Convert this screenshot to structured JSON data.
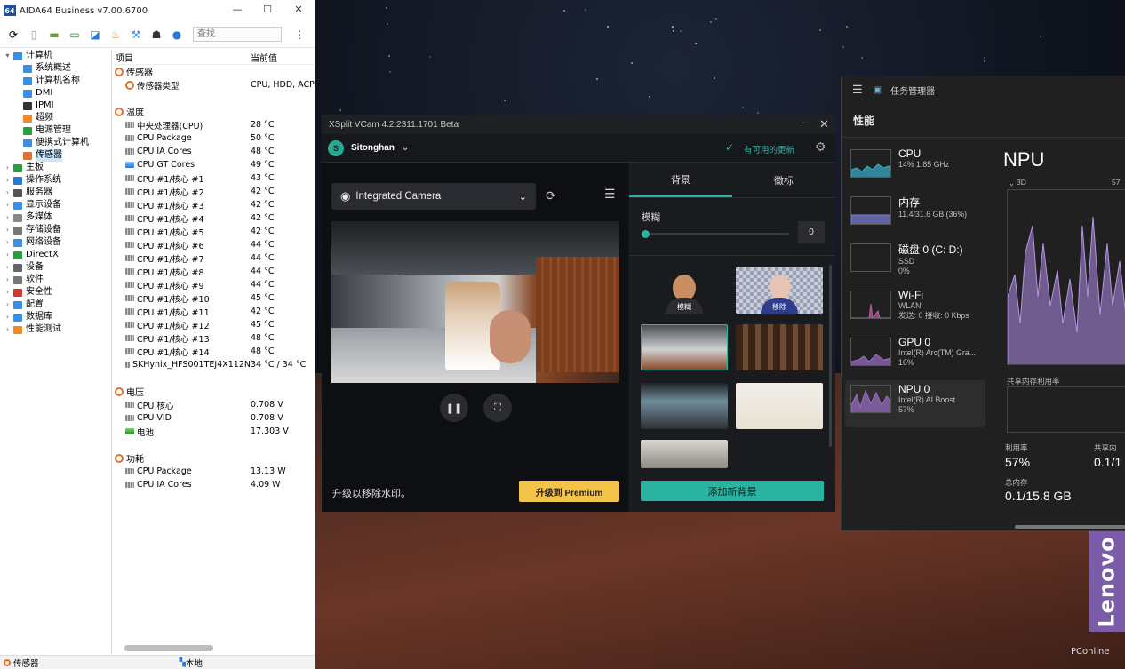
{
  "aida": {
    "title": "AIDA64 Business v7.00.6700",
    "search_placeholder": "查找",
    "tree": [
      {
        "label": "计算机",
        "indent": 0,
        "exp": "▾",
        "color": "#3a8ee6"
      },
      {
        "label": "系统概述",
        "indent": 1,
        "color": "#3a8ee6"
      },
      {
        "label": "计算机名称",
        "indent": 1,
        "color": "#3a8ee6"
      },
      {
        "label": "DMI",
        "indent": 1,
        "color": "#3a8ee6"
      },
      {
        "label": "IPMI",
        "indent": 1,
        "color": "#333"
      },
      {
        "label": "超频",
        "indent": 1,
        "color": "#f08a24"
      },
      {
        "label": "电源管理",
        "indent": 1,
        "color": "#2a9d3c"
      },
      {
        "label": "便携式计算机",
        "indent": 1,
        "color": "#3a8ee6"
      },
      {
        "label": "传感器",
        "indent": 1,
        "color": "#e5702a",
        "sel": true
      },
      {
        "label": "主板",
        "indent": 0,
        "exp": "›",
        "color": "#2a9d3c"
      },
      {
        "label": "操作系统",
        "indent": 0,
        "exp": "›",
        "color": "#2a78d0"
      },
      {
        "label": "服务器",
        "indent": 0,
        "exp": "›",
        "color": "#555"
      },
      {
        "label": "显示设备",
        "indent": 0,
        "exp": "›",
        "color": "#3a8ee6"
      },
      {
        "label": "多媒体",
        "indent": 0,
        "exp": "›",
        "color": "#888"
      },
      {
        "label": "存储设备",
        "indent": 0,
        "exp": "›",
        "color": "#777"
      },
      {
        "label": "网络设备",
        "indent": 0,
        "exp": "›",
        "color": "#3a8ee6"
      },
      {
        "label": "DirectX",
        "indent": 0,
        "exp": "›",
        "color": "#2a9d3c"
      },
      {
        "label": "设备",
        "indent": 0,
        "exp": "›",
        "color": "#666"
      },
      {
        "label": "软件",
        "indent": 0,
        "exp": "›",
        "color": "#777"
      },
      {
        "label": "安全性",
        "indent": 0,
        "exp": "›",
        "color": "#d03a2a"
      },
      {
        "label": "配置",
        "indent": 0,
        "exp": "›",
        "color": "#3a8ee6"
      },
      {
        "label": "数据库",
        "indent": 0,
        "exp": "›",
        "color": "#3a8ee6"
      },
      {
        "label": "性能测试",
        "indent": 0,
        "exp": "›",
        "color": "#f08a24"
      }
    ],
    "list_headers": {
      "item": "项目",
      "value": "当前值"
    },
    "rows": [
      {
        "t": "sec",
        "label": "传感器"
      },
      {
        "t": "row",
        "icon": "sensor",
        "label": "传感器类型",
        "value": "CPU, HDD, ACPI,"
      },
      {
        "t": "gap"
      },
      {
        "t": "sec",
        "label": "温度"
      },
      {
        "t": "row",
        "icon": "chip",
        "label": "中央处理器(CPU)",
        "value": "28 °C"
      },
      {
        "t": "row",
        "icon": "chip",
        "label": "CPU Package",
        "value": "50 °C"
      },
      {
        "t": "row",
        "icon": "chip",
        "label": "CPU IA Cores",
        "value": "48 °C"
      },
      {
        "t": "row",
        "icon": "blue",
        "label": "CPU GT Cores",
        "value": "49 °C"
      },
      {
        "t": "row",
        "icon": "chip",
        "label": "CPU #1/核心 #1",
        "value": "43 °C"
      },
      {
        "t": "row",
        "icon": "chip",
        "label": "CPU #1/核心 #2",
        "value": "42 °C"
      },
      {
        "t": "row",
        "icon": "chip",
        "label": "CPU #1/核心 #3",
        "value": "42 °C"
      },
      {
        "t": "row",
        "icon": "chip",
        "label": "CPU #1/核心 #4",
        "value": "42 °C"
      },
      {
        "t": "row",
        "icon": "chip",
        "label": "CPU #1/核心 #5",
        "value": "42 °C"
      },
      {
        "t": "row",
        "icon": "chip",
        "label": "CPU #1/核心 #6",
        "value": "44 °C"
      },
      {
        "t": "row",
        "icon": "chip",
        "label": "CPU #1/核心 #7",
        "value": "44 °C"
      },
      {
        "t": "row",
        "icon": "chip",
        "label": "CPU #1/核心 #8",
        "value": "44 °C"
      },
      {
        "t": "row",
        "icon": "chip",
        "label": "CPU #1/核心 #9",
        "value": "44 °C"
      },
      {
        "t": "row",
        "icon": "chip",
        "label": "CPU #1/核心 #10",
        "value": "45 °C"
      },
      {
        "t": "row",
        "icon": "chip",
        "label": "CPU #1/核心 #11",
        "value": "42 °C"
      },
      {
        "t": "row",
        "icon": "chip",
        "label": "CPU #1/核心 #12",
        "value": "45 °C"
      },
      {
        "t": "row",
        "icon": "chip",
        "label": "CPU #1/核心 #13",
        "value": "48 °C"
      },
      {
        "t": "row",
        "icon": "chip",
        "label": "CPU #1/核心 #14",
        "value": "48 °C"
      },
      {
        "t": "row",
        "icon": "disk",
        "label": "SKHynix_HFS001TEJ4X112N",
        "value": "34 °C / 34 °C"
      },
      {
        "t": "gap"
      },
      {
        "t": "sec",
        "label": "电压"
      },
      {
        "t": "row",
        "icon": "chip",
        "label": "CPU 核心",
        "value": "0.708 V"
      },
      {
        "t": "row",
        "icon": "chip",
        "label": "CPU VID",
        "value": "0.708 V"
      },
      {
        "t": "row",
        "icon": "green",
        "label": "电池",
        "value": "17.303 V"
      },
      {
        "t": "gap"
      },
      {
        "t": "sec",
        "label": "功耗"
      },
      {
        "t": "row",
        "icon": "chip",
        "label": "CPU Package",
        "value": "13.13 W"
      },
      {
        "t": "row",
        "icon": "chip",
        "label": "CPU IA Cores",
        "value": "4.09 W"
      }
    ],
    "status_left": "传感器",
    "status_right": "本地"
  },
  "xsplit": {
    "title": "XSplit VCam 4.2.2311.1701 Beta",
    "user_initial": "S",
    "user_name": "Sitonghan",
    "update_text": "有可用的更新",
    "camera": "Integrated Camera",
    "tab_background": "背景",
    "tab_logo": "徽标",
    "blur_label": "模糊",
    "blur_value": "0",
    "blur_level": 0,
    "thumb_blur": "模糊",
    "thumb_remove": "移除",
    "upgrade_text": "升级以移除水印。",
    "upgrade_btn": "升级到 Premium",
    "add_bg_btn": "添加新背景"
  },
  "taskman": {
    "title": "任务管理器",
    "section": "性能",
    "items": [
      {
        "name": "CPU",
        "sub1": "14%  1.85 GHz",
        "sub2": "",
        "color": "#3bb0c9"
      },
      {
        "name": "内存",
        "sub1": "11.4/31.6 GB (36%)",
        "sub2": "",
        "color": "#7b82d8"
      },
      {
        "name": "磁盘 0 (C: D:)",
        "sub1": "SSD",
        "sub2": "0%",
        "color": "#5ba85b"
      },
      {
        "name": "Wi-Fi",
        "sub1": "WLAN",
        "sub2": "发送: 0 接收: 0 Kbps",
        "color": "#c25da0"
      },
      {
        "name": "GPU 0",
        "sub1": "Intel(R) Arc(TM) Gra...",
        "sub2": "16%",
        "color": "#9b6fc4"
      },
      {
        "name": "NPU 0",
        "sub1": "Intel(R) AI Boost",
        "sub2": "57%",
        "color": "#9b6fc4"
      }
    ],
    "big_title": "NPU",
    "graph_label": "3D",
    "graph_pct": "57",
    "shared_label": "共享内存利用率",
    "util_label": "利用率",
    "util_value": "57%",
    "shared_lbl2": "共享内",
    "shared_val2": "0.1/1",
    "total_label": "总内存",
    "total_value": "0.1/15.8 GB"
  },
  "brand": {
    "lenovo": "Lenovo",
    "pconline": "PConline"
  }
}
